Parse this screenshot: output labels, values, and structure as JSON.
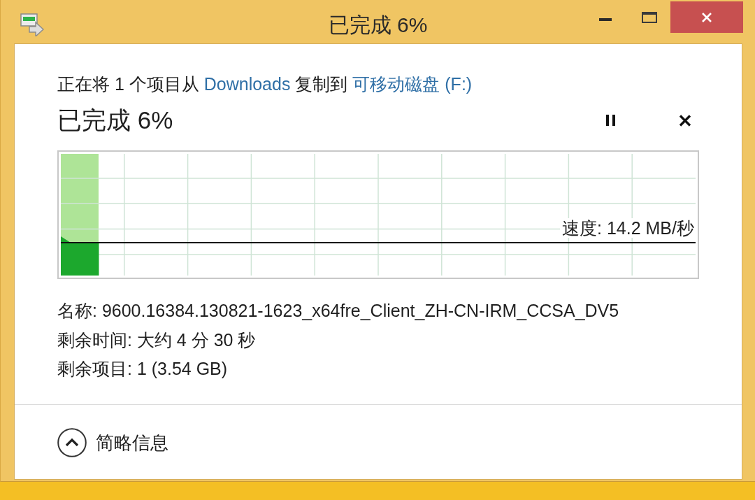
{
  "window": {
    "title": "已完成 6%"
  },
  "copy_summary": {
    "parts": [
      {
        "kind": "text",
        "text": "正在将 1 个项目从"
      },
      {
        "kind": "link",
        "text": "Downloads"
      },
      {
        "kind": "text",
        "text": "复制到"
      },
      {
        "kind": "link",
        "text": "可移动磁盘 (F:)"
      }
    ]
  },
  "progress": {
    "status": "已完成 6%",
    "level": 0.06,
    "speed": "速度: 14.2 MB/秒"
  },
  "details": [
    "名称: 9600.16384.130821-1623_x64fre_Client_ZH-CN-IRM_CCSA_DV5",
    "剩余时间: 大约 4 分 30 秒",
    "剩余项目: 1 (3.54 GB)"
  ],
  "footer": {
    "label": "简略信息",
    "expanded": true
  }
}
